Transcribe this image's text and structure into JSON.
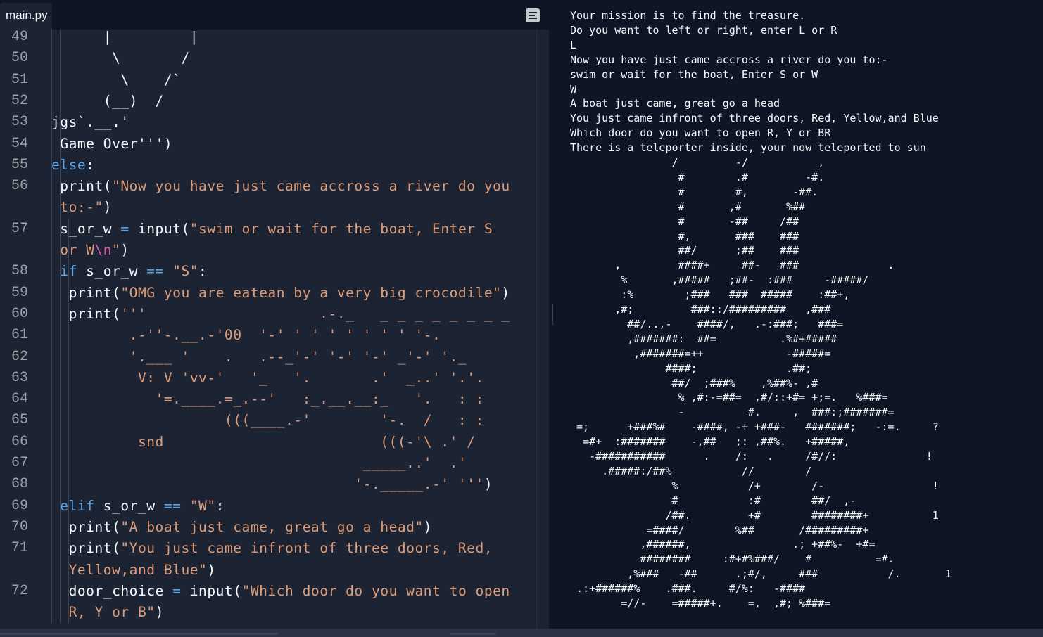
{
  "editor": {
    "tab_label": "main.py",
    "tab_menu_icon": "pane-menu-icon",
    "lines": [
      {
        "n": "49",
        "rows": [
          [
            {
              "c": "def",
              "v": "      |         |"
            }
          ]
        ]
      },
      {
        "n": "50",
        "rows": [
          [
            {
              "c": "def",
              "v": "       \\       /"
            }
          ]
        ]
      },
      {
        "n": "51",
        "rows": [
          [
            {
              "c": "def",
              "v": "        \\    /`"
            }
          ]
        ]
      },
      {
        "n": "52",
        "rows": [
          [
            {
              "c": "def",
              "v": "      (__)  /"
            }
          ]
        ]
      },
      {
        "n": "53",
        "rows": [
          [
            {
              "c": "def",
              "v": "jgs`.__.'"
            }
          ]
        ]
      },
      {
        "n": "54",
        "rows": [
          [
            {
              "c": "def",
              "v": " Game Over''')"
            }
          ]
        ]
      },
      {
        "n": "55",
        "rows": [
          [
            {
              "c": "kw",
              "v": "else"
            },
            {
              "c": "def",
              "v": ":"
            }
          ]
        ]
      },
      {
        "n": "56",
        "rows": [
          [
            {
              "c": "def",
              "v": " "
            },
            {
              "c": "fn",
              "v": "print"
            },
            {
              "c": "def",
              "v": "("
            },
            {
              "c": "str",
              "v": "\"Now you have just came accross a river do you"
            }
          ],
          [
            {
              "c": "str",
              "v": " to:-\""
            },
            {
              "c": "def",
              "v": ")"
            }
          ]
        ]
      },
      {
        "n": "57",
        "rows": [
          [
            {
              "c": "def",
              "v": " s_or_w "
            },
            {
              "c": "op",
              "v": "="
            },
            {
              "c": "def",
              "v": " "
            },
            {
              "c": "fn",
              "v": "input"
            },
            {
              "c": "def",
              "v": "("
            },
            {
              "c": "str",
              "v": "\"swim or wait for the boat, Enter S"
            }
          ],
          [
            {
              "c": "str",
              "v": " or W"
            },
            {
              "c": "esc",
              "v": "\\n"
            },
            {
              "c": "str",
              "v": "\""
            },
            {
              "c": "def",
              "v": ")"
            }
          ]
        ]
      },
      {
        "n": "58",
        "rows": [
          [
            {
              "c": "def",
              "v": " "
            },
            {
              "c": "kw",
              "v": "if"
            },
            {
              "c": "def",
              "v": " s_or_w "
            },
            {
              "c": "op",
              "v": "=="
            },
            {
              "c": "def",
              "v": " "
            },
            {
              "c": "str",
              "v": "\"S\""
            },
            {
              "c": "def",
              "v": ":"
            }
          ]
        ]
      },
      {
        "n": "59",
        "rows": [
          [
            {
              "c": "def",
              "v": "  "
            },
            {
              "c": "fn",
              "v": "print"
            },
            {
              "c": "def",
              "v": "("
            },
            {
              "c": "str",
              "v": "\"OMG you are eatean by a very big crocodile\""
            },
            {
              "c": "def",
              "v": ")"
            }
          ]
        ]
      },
      {
        "n": "60",
        "rows": [
          [
            {
              "c": "def",
              "v": "  "
            },
            {
              "c": "fn",
              "v": "print"
            },
            {
              "c": "def",
              "v": "("
            },
            {
              "c": "str",
              "v": "'''                    .-._   _ _ _ _ _ _ _ _"
            }
          ]
        ]
      },
      {
        "n": "61",
        "rows": [
          [
            {
              "c": "str",
              "v": "         .-''-.__.-'00  '-' ' ' ' ' ' ' ' '-."
            }
          ]
        ]
      },
      {
        "n": "62",
        "rows": [
          [
            {
              "c": "str",
              "v": "         '.___ '    .   .--_'-' '-' '-' _'-' '._"
            }
          ]
        ]
      },
      {
        "n": "63",
        "rows": [
          [
            {
              "c": "str",
              "v": "          V: V 'vv-'   '_   '.       .'  _..' '.'."
            }
          ]
        ]
      },
      {
        "n": "64",
        "rows": [
          [
            {
              "c": "str",
              "v": "            '=.____.=_.--'   :_.__.__:_   '.   : :"
            }
          ]
        ]
      },
      {
        "n": "65",
        "rows": [
          [
            {
              "c": "str",
              "v": "                    (((____.-'        '-.  /   : :"
            }
          ]
        ]
      },
      {
        "n": "66",
        "rows": [
          [
            {
              "c": "str",
              "v": "          snd                         (((-'\\ .' /"
            }
          ]
        ]
      },
      {
        "n": "67",
        "rows": [
          [
            {
              "c": "str",
              "v": "                                    _____..'  .'"
            }
          ]
        ]
      },
      {
        "n": "68",
        "rows": [
          [
            {
              "c": "str",
              "v": "                                   '-._____.-' '''"
            },
            {
              "c": "def",
              "v": ")"
            }
          ]
        ]
      },
      {
        "n": "69",
        "rows": [
          [
            {
              "c": "def",
              "v": " "
            },
            {
              "c": "kw",
              "v": "elif"
            },
            {
              "c": "def",
              "v": " s_or_w "
            },
            {
              "c": "op",
              "v": "=="
            },
            {
              "c": "def",
              "v": " "
            },
            {
              "c": "str",
              "v": "\"W\""
            },
            {
              "c": "def",
              "v": ":"
            }
          ]
        ]
      },
      {
        "n": "70",
        "rows": [
          [
            {
              "c": "def",
              "v": "  "
            },
            {
              "c": "fn",
              "v": "print"
            },
            {
              "c": "def",
              "v": "("
            },
            {
              "c": "str",
              "v": "\"A boat just came, great go a head\""
            },
            {
              "c": "def",
              "v": ")"
            }
          ]
        ]
      },
      {
        "n": "71",
        "rows": [
          [
            {
              "c": "def",
              "v": "  "
            },
            {
              "c": "fn",
              "v": "print"
            },
            {
              "c": "def",
              "v": "("
            },
            {
              "c": "str",
              "v": "\"You just came infront of three doors, Red,"
            }
          ],
          [
            {
              "c": "str",
              "v": "  Yellow,and Blue\""
            },
            {
              "c": "def",
              "v": ")"
            }
          ]
        ]
      },
      {
        "n": "72",
        "rows": [
          [
            {
              "c": "def",
              "v": "  door_choice "
            },
            {
              "c": "op",
              "v": "="
            },
            {
              "c": "def",
              "v": " "
            },
            {
              "c": "fn",
              "v": "input"
            },
            {
              "c": "def",
              "v": "("
            },
            {
              "c": "str",
              "v": "\"Which door do you want to open"
            }
          ],
          [
            {
              "c": "str",
              "v": "  R, Y or B\""
            },
            {
              "c": "def",
              "v": ")"
            }
          ]
        ]
      }
    ]
  },
  "console": {
    "lines": [
      "Your mission is to find the treasure.",
      "Do you want to left or right, enter L or R",
      "L",
      "Now you have just came accross a river do you to:-",
      "swim or wait for the boat, Enter S or W",
      "W",
      "A boat just came, great go a head",
      "You just came infront of three doors, Red, Yellow,and Blue",
      "Which door do you want to open R, Y or BR",
      "There is a teleporter inside, your now teleported to sun",
      "                /         -/           ,",
      "                 #        .#         -#.",
      "                 #        #,       -##.",
      "                 #       ,#       %##",
      "                 #       -##     /##",
      "                 #,       ###    ###",
      "                 ##/      ;##    ###",
      "       ,         ####+     ##-   ###              .",
      "        %       ,#####   ;##-  :###     -#####/",
      "        :%        ;###   ###  #####    :##+,",
      "       ,#;         ###::/#########   ,###",
      "         ##/..,-    ####/,   .-:###;   ###=",
      "         ,#######:  ##=          .%#+#####",
      "          ,#######=++             -#####=",
      "               ####;              .##;",
      "                ##/  ;###%    ,%##%- ,#",
      "                 % ,#:-=##=  ,#/::+#= +;=.   %###=",
      "                 -          #.     ,  ###:;#######=",
      " =;      +###%#    -####, -+ +###-   #######;   -:=.     ?",
      "  =#+  :#######    -,##   ;: ,##%.   +#####,",
      "   -###########      .    /:   .     /#//:              !",
      "     .#####:/##%           //        /",
      "                %           /+        /-                 !",
      "                #           :#        ##/  ,-",
      "               /##.         +#        ########+          1",
      "            =####/        %##       /#########+",
      "           ,######,                .; +##%-  +#=",
      "           ########     :#+#%###/    #          =#.",
      "         ,%###   -##      .;#/,     ###           /.       1",
      " .:+######%    .###.     #/%:   -####",
      "        =//-    =#####+.    =,  ,#; %###="
    ]
  }
}
